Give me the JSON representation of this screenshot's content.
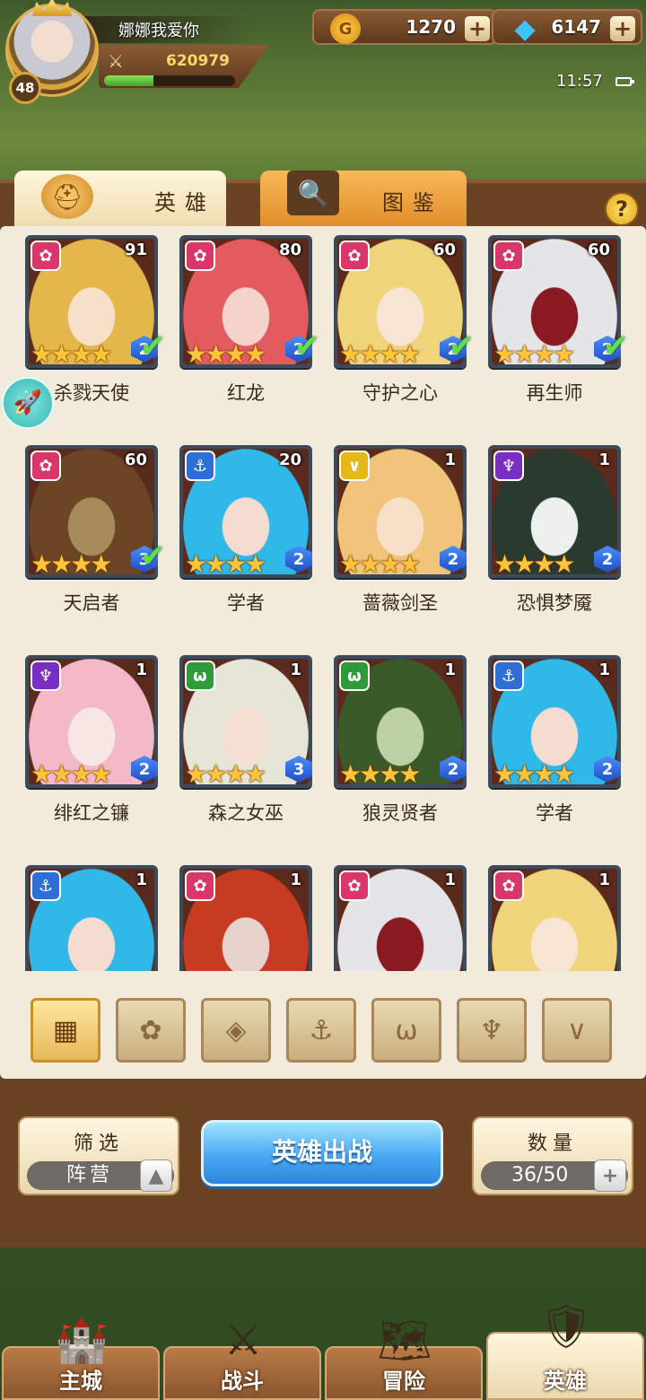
{
  "player": {
    "name": "娜娜我爱你",
    "level": "48",
    "power": "620979",
    "xp_progress": 0.38
  },
  "currency": {
    "gold": "1270",
    "gems": "6147",
    "plus": "+"
  },
  "status": {
    "time": "11:57"
  },
  "tabs": {
    "hero": "英雄",
    "codex": "图鉴"
  },
  "help_icon": "?",
  "heroes": [
    {
      "name": "杀戮天使",
      "level": "91",
      "rank": "2",
      "faction": "flower",
      "checked": true,
      "palette": [
        "#e3b74a",
        "#f7dfc9"
      ]
    },
    {
      "name": "红龙",
      "level": "80",
      "rank": "2",
      "faction": "flower",
      "checked": true,
      "palette": [
        "#e35a5f",
        "#f5d3cc"
      ]
    },
    {
      "name": "守护之心",
      "level": "60",
      "rank": "2",
      "faction": "flower",
      "checked": true,
      "palette": [
        "#f0d47a",
        "#f8e4d3"
      ]
    },
    {
      "name": "再生师",
      "level": "60",
      "rank": "2",
      "faction": "flower",
      "checked": true,
      "palette": [
        "#e5e5e8",
        "#8a1a22"
      ]
    },
    {
      "name": "天启者",
      "level": "60",
      "rank": "3",
      "faction": "flower",
      "checked": true,
      "palette": [
        "#6b4526",
        "#a88b5a"
      ]
    },
    {
      "name": "学者",
      "level": "20",
      "rank": "2",
      "faction": "anchor",
      "checked": false,
      "palette": [
        "#2fb8e8",
        "#f4ddd0"
      ]
    },
    {
      "name": "蔷薇剑圣",
      "level": "1",
      "rank": "2",
      "faction": "v",
      "checked": false,
      "palette": [
        "#f0c47a",
        "#f7e0c8"
      ]
    },
    {
      "name": "恐惧梦魇",
      "level": "1",
      "rank": "2",
      "faction": "demon",
      "checked": false,
      "palette": [
        "#2a3a2e",
        "#ecf0ee"
      ]
    },
    {
      "name": "绯红之镰",
      "level": "1",
      "rank": "2",
      "faction": "demon",
      "checked": false,
      "palette": [
        "#f4b9c7",
        "#f8e6e4"
      ]
    },
    {
      "name": "森之女巫",
      "level": "1",
      "rank": "3",
      "faction": "beast",
      "checked": false,
      "palette": [
        "#e5e5d8",
        "#f6e0d2"
      ]
    },
    {
      "name": "狼灵贤者",
      "level": "1",
      "rank": "2",
      "faction": "beast",
      "checked": false,
      "palette": [
        "#3b5a2a",
        "#bdd0a6"
      ]
    },
    {
      "name": "学者",
      "level": "1",
      "rank": "2",
      "faction": "anchor",
      "checked": false,
      "palette": [
        "#2fb8e8",
        "#f4ddd0"
      ]
    },
    {
      "name": "",
      "level": "1",
      "rank": "",
      "faction": "anchor",
      "checked": false,
      "palette": [
        "#2fb8e8",
        "#f4ddd0"
      ]
    },
    {
      "name": "",
      "level": "1",
      "rank": "",
      "faction": "flower",
      "checked": false,
      "palette": [
        "#c73b22",
        "#e8d3cc"
      ]
    },
    {
      "name": "",
      "level": "1",
      "rank": "",
      "faction": "flower",
      "checked": false,
      "palette": [
        "#e5e5e8",
        "#8a1a22"
      ]
    },
    {
      "name": "",
      "level": "1",
      "rank": "",
      "faction": "flower",
      "checked": false,
      "palette": [
        "#f0d47a",
        "#f8e4d3"
      ]
    }
  ],
  "faction_colors": {
    "flower": "#d9376a",
    "anchor": "#2d6fd6",
    "v": "#e5b81a",
    "demon": "#7a2fc4",
    "beast": "#2f9a3a"
  },
  "faction_glyphs": {
    "flower": "✿",
    "anchor": "⚓",
    "v": "∨",
    "demon": "♆",
    "beast": "ω"
  },
  "filters": [
    {
      "icon": "grid-icon",
      "glyph": "▦",
      "active": true
    },
    {
      "icon": "flower-icon",
      "glyph": "✿",
      "active": false
    },
    {
      "icon": "diamond-icon",
      "glyph": "◈",
      "active": false
    },
    {
      "icon": "anchor-icon",
      "glyph": "⚓",
      "active": false
    },
    {
      "icon": "beast-icon",
      "glyph": "ω",
      "active": false
    },
    {
      "icon": "demon-icon",
      "glyph": "♆",
      "active": false
    },
    {
      "icon": "v-icon",
      "glyph": "∨",
      "active": false
    }
  ],
  "controls": {
    "filter_title": "筛选",
    "filter_value": "阵营",
    "deploy": "英雄出战",
    "count_title": "数量",
    "count_value": "36/50"
  },
  "nav": [
    {
      "label": "主城",
      "icon": "city-icon",
      "glyph": "🏰",
      "active": false
    },
    {
      "label": "战斗",
      "icon": "swords-icon",
      "glyph": "⚔",
      "active": false
    },
    {
      "label": "冒险",
      "icon": "adventure-icon",
      "glyph": "🗺",
      "active": false
    },
    {
      "label": "英雄",
      "icon": "hero-icon",
      "glyph": "🛡",
      "active": true
    }
  ]
}
